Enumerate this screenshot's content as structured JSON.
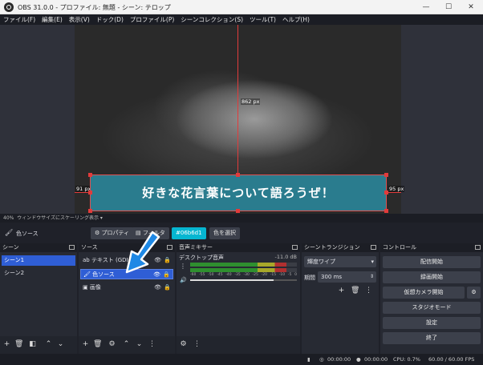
{
  "window": {
    "title": "OBS 31.0.0 - プロファイル: 無題 - シーン: テロップ",
    "min": "—",
    "max": "☐",
    "close": "✕"
  },
  "menu": [
    "ファイル(F)",
    "編集(E)",
    "表示(V)",
    "ドック(D)",
    "プロファイル(P)",
    "シーンコレクション(S)",
    "ツール(T)",
    "ヘルプ(H)"
  ],
  "preview": {
    "caption": "好きな花言葉について語ろうぜ！",
    "dim_top": "862 px",
    "dim_left": "91 px",
    "dim_right": "95 px",
    "zoom": "40%",
    "scale_mode": "ウィンドウサイズにスケーリング表示"
  },
  "source_toolbar": {
    "source_name": "色ソース",
    "properties": "プロパティ",
    "filters": "フィルタ",
    "color_hex": "#06b6d1",
    "pick_color": "色を選択"
  },
  "scenes": {
    "title": "シーン",
    "items": [
      "シーン1",
      "シーン2"
    ],
    "selected": 0
  },
  "sources": {
    "title": "ソース",
    "items": [
      {
        "name": "テキスト (GDI+)",
        "icon": "ab"
      },
      {
        "name": "色ソース",
        "icon": "brush"
      },
      {
        "name": "画像",
        "icon": "image"
      }
    ],
    "selected": 1
  },
  "mixer": {
    "title": "音声ミキサー",
    "track": "デスクトップ音声",
    "db": "-11.0 dB",
    "scale": [
      "-60",
      "-55",
      "-50",
      "-45",
      "-40",
      "-35",
      "-30",
      "-25",
      "-20",
      "-15",
      "-10",
      "-5",
      "0"
    ],
    "level": 0.9,
    "volume": 0.78
  },
  "transitions": {
    "title": "シーントランジション",
    "type": "輝度ワイプ",
    "duration_label": "期間",
    "duration": "300 ms"
  },
  "controls": {
    "title": "コントロール",
    "buttons": [
      "配信開始",
      "録画開始",
      "仮想カメラ開始",
      "スタジオモード",
      "設定",
      "終了"
    ]
  },
  "status": {
    "stream_time": "00:00:00",
    "rec_time": "00:00:00",
    "cpu": "CPU: 0.7%",
    "fps": "60.00 / 60.00 FPS"
  },
  "colors": {
    "accent": "#2f5ed5",
    "caption_bg": "#2a7c8e",
    "guide": "#e23b3b",
    "color_swatch": "#06b6d1",
    "arrow": "#1e88e5"
  }
}
